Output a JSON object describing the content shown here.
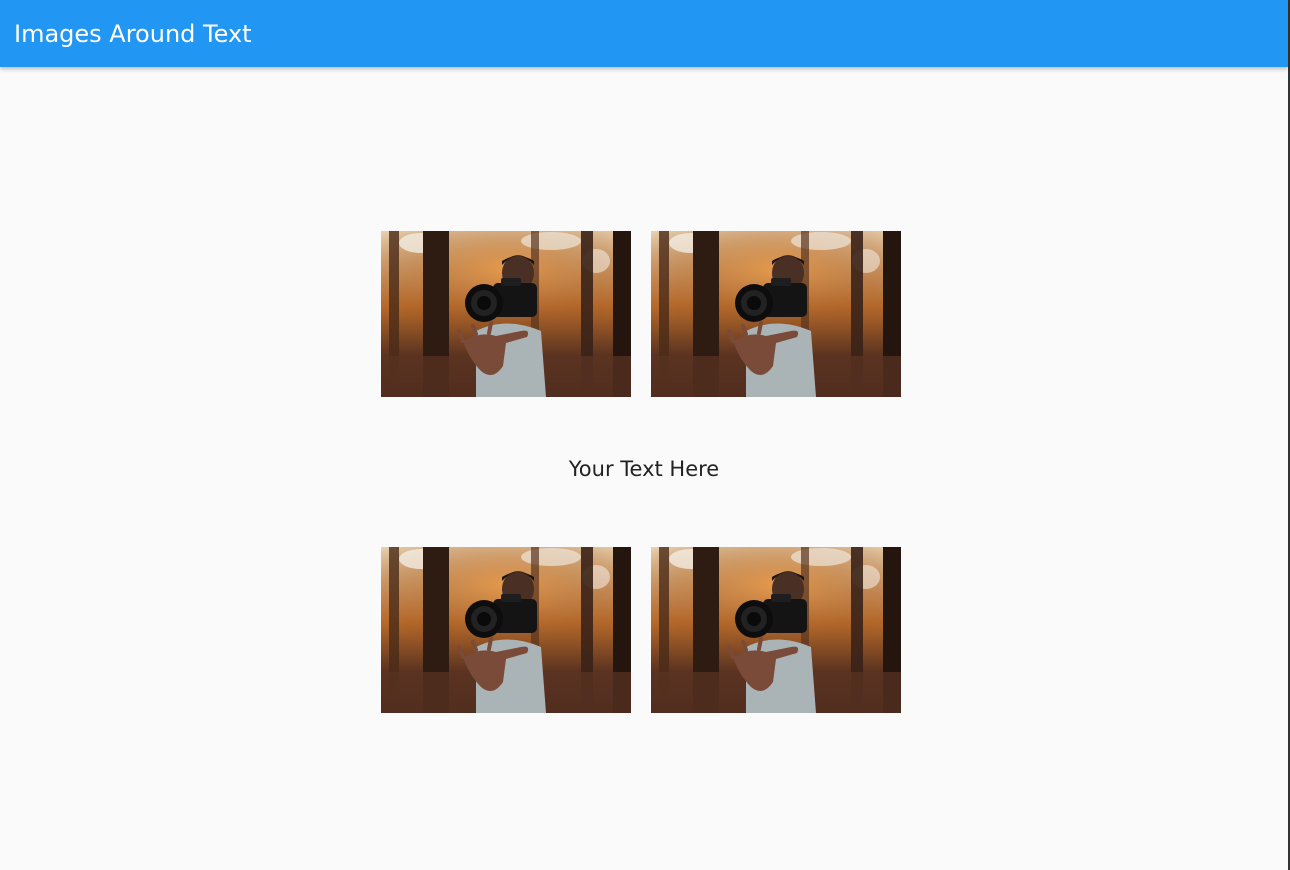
{
  "app_bar": {
    "title": "Images Around Text",
    "background_color": "#2196f3"
  },
  "main": {
    "center_text": "Your Text Here",
    "top_row": [
      {
        "image": "person-throwing-camera-forest-photo"
      },
      {
        "image": "person-throwing-camera-forest-photo"
      }
    ],
    "bottom_row": [
      {
        "image": "person-throwing-camera-forest-photo"
      },
      {
        "image": "person-throwing-camera-forest-photo"
      }
    ]
  }
}
